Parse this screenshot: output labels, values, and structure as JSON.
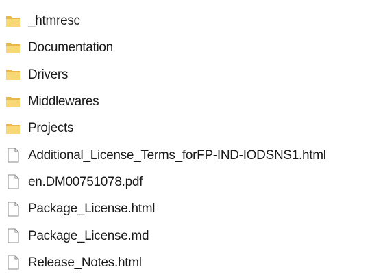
{
  "items": [
    {
      "name": "_htmresc",
      "type": "folder",
      "icon": "folder-icon"
    },
    {
      "name": "Documentation",
      "type": "folder",
      "icon": "folder-icon"
    },
    {
      "name": "Drivers",
      "type": "folder",
      "icon": "folder-icon"
    },
    {
      "name": "Middlewares",
      "type": "folder",
      "icon": "folder-icon"
    },
    {
      "name": "Projects",
      "type": "folder",
      "icon": "folder-icon"
    },
    {
      "name": "Additional_License_Terms_forFP-IND-IODSNS1.html",
      "type": "file",
      "icon": "file-icon"
    },
    {
      "name": "en.DM00751078.pdf",
      "type": "file",
      "icon": "file-icon"
    },
    {
      "name": "Package_License.html",
      "type": "file",
      "icon": "file-icon"
    },
    {
      "name": "Package_License.md",
      "type": "file",
      "icon": "file-icon"
    },
    {
      "name": "Release_Notes.html",
      "type": "file",
      "icon": "file-icon"
    }
  ],
  "colors": {
    "folder_fill": "#F8D775",
    "folder_back": "#E8B84A",
    "file_outline": "#8a8a8a",
    "text": "#1a1a1a"
  }
}
